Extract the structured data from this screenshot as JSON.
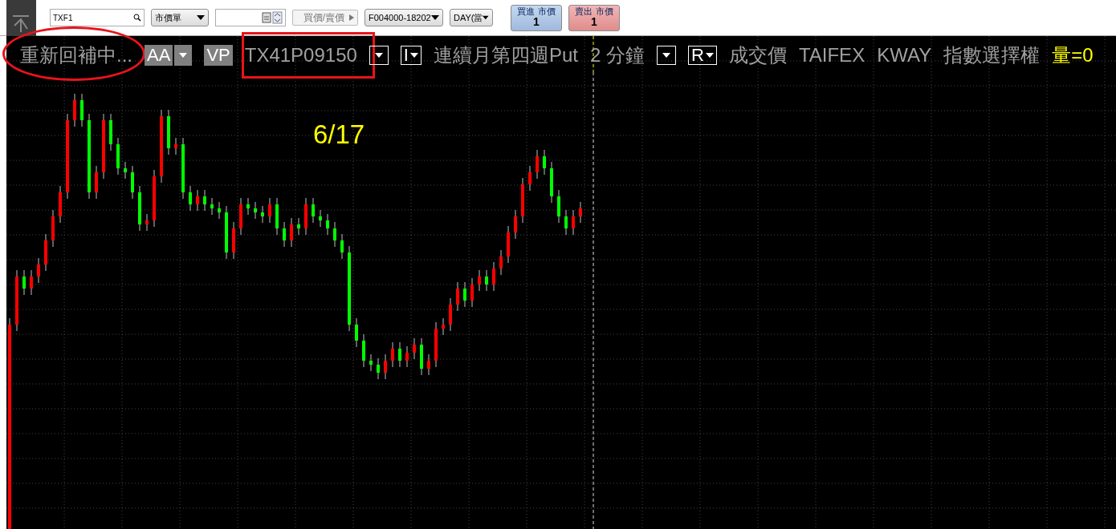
{
  "toolbar": {
    "symbol_field": {
      "value": "TXF1"
    },
    "order_type": {
      "value": "市價單"
    },
    "price_button": {
      "label": "買價/賣價",
      "disabled": true
    },
    "account_select": {
      "value": "F004000-18202"
    },
    "duration_select": {
      "value": "DAY(當"
    },
    "buy_button": {
      "label": "買進 市價",
      "quantity": "1"
    },
    "sell_button": {
      "label": "賣出 市價",
      "quantity": "1"
    }
  },
  "chart_header": {
    "status": "重新回補中...",
    "items": [
      {
        "kind": "gray-box",
        "label": "AA"
      },
      {
        "kind": "gray-dropdown"
      },
      {
        "kind": "gray-box",
        "label": "VP"
      },
      {
        "kind": "text",
        "label": "TX41P09150"
      },
      {
        "kind": "dropdown"
      },
      {
        "kind": "dropdown",
        "label": "I"
      },
      {
        "kind": "text",
        "label": "連續月第四週Put"
      },
      {
        "kind": "text",
        "label": "2 分鐘"
      },
      {
        "kind": "dropdown"
      },
      {
        "kind": "dropdown",
        "label": "R"
      },
      {
        "kind": "text",
        "label": "成交價"
      },
      {
        "kind": "text",
        "label": "TAIFEX"
      },
      {
        "kind": "text",
        "label": "KWAY"
      },
      {
        "kind": "text",
        "label": "指數選擇權"
      },
      {
        "kind": "highlight",
        "label": "量=0"
      }
    ]
  },
  "chart": {
    "date_label": "6/17"
  },
  "annotations": [
    {
      "kind": "ellipse"
    },
    {
      "kind": "rectangle"
    }
  ]
}
